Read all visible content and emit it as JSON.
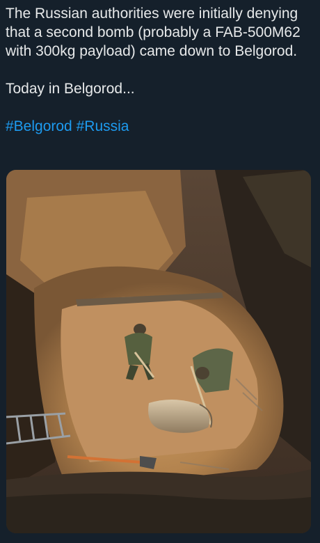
{
  "post": {
    "paragraph_1": "The Russian authorities were initially denying that a second bomb (probably a FAB-500M62 with 300kg payload) came down to Belgorod.",
    "paragraph_2": "Today in Belgorod...",
    "hashtags": [
      "#Belgorod",
      "#Russia"
    ]
  },
  "colors": {
    "background": "#15202b",
    "text": "#e7e9ea",
    "link": "#1d9bf0"
  },
  "media": {
    "description_icon": "photo"
  }
}
